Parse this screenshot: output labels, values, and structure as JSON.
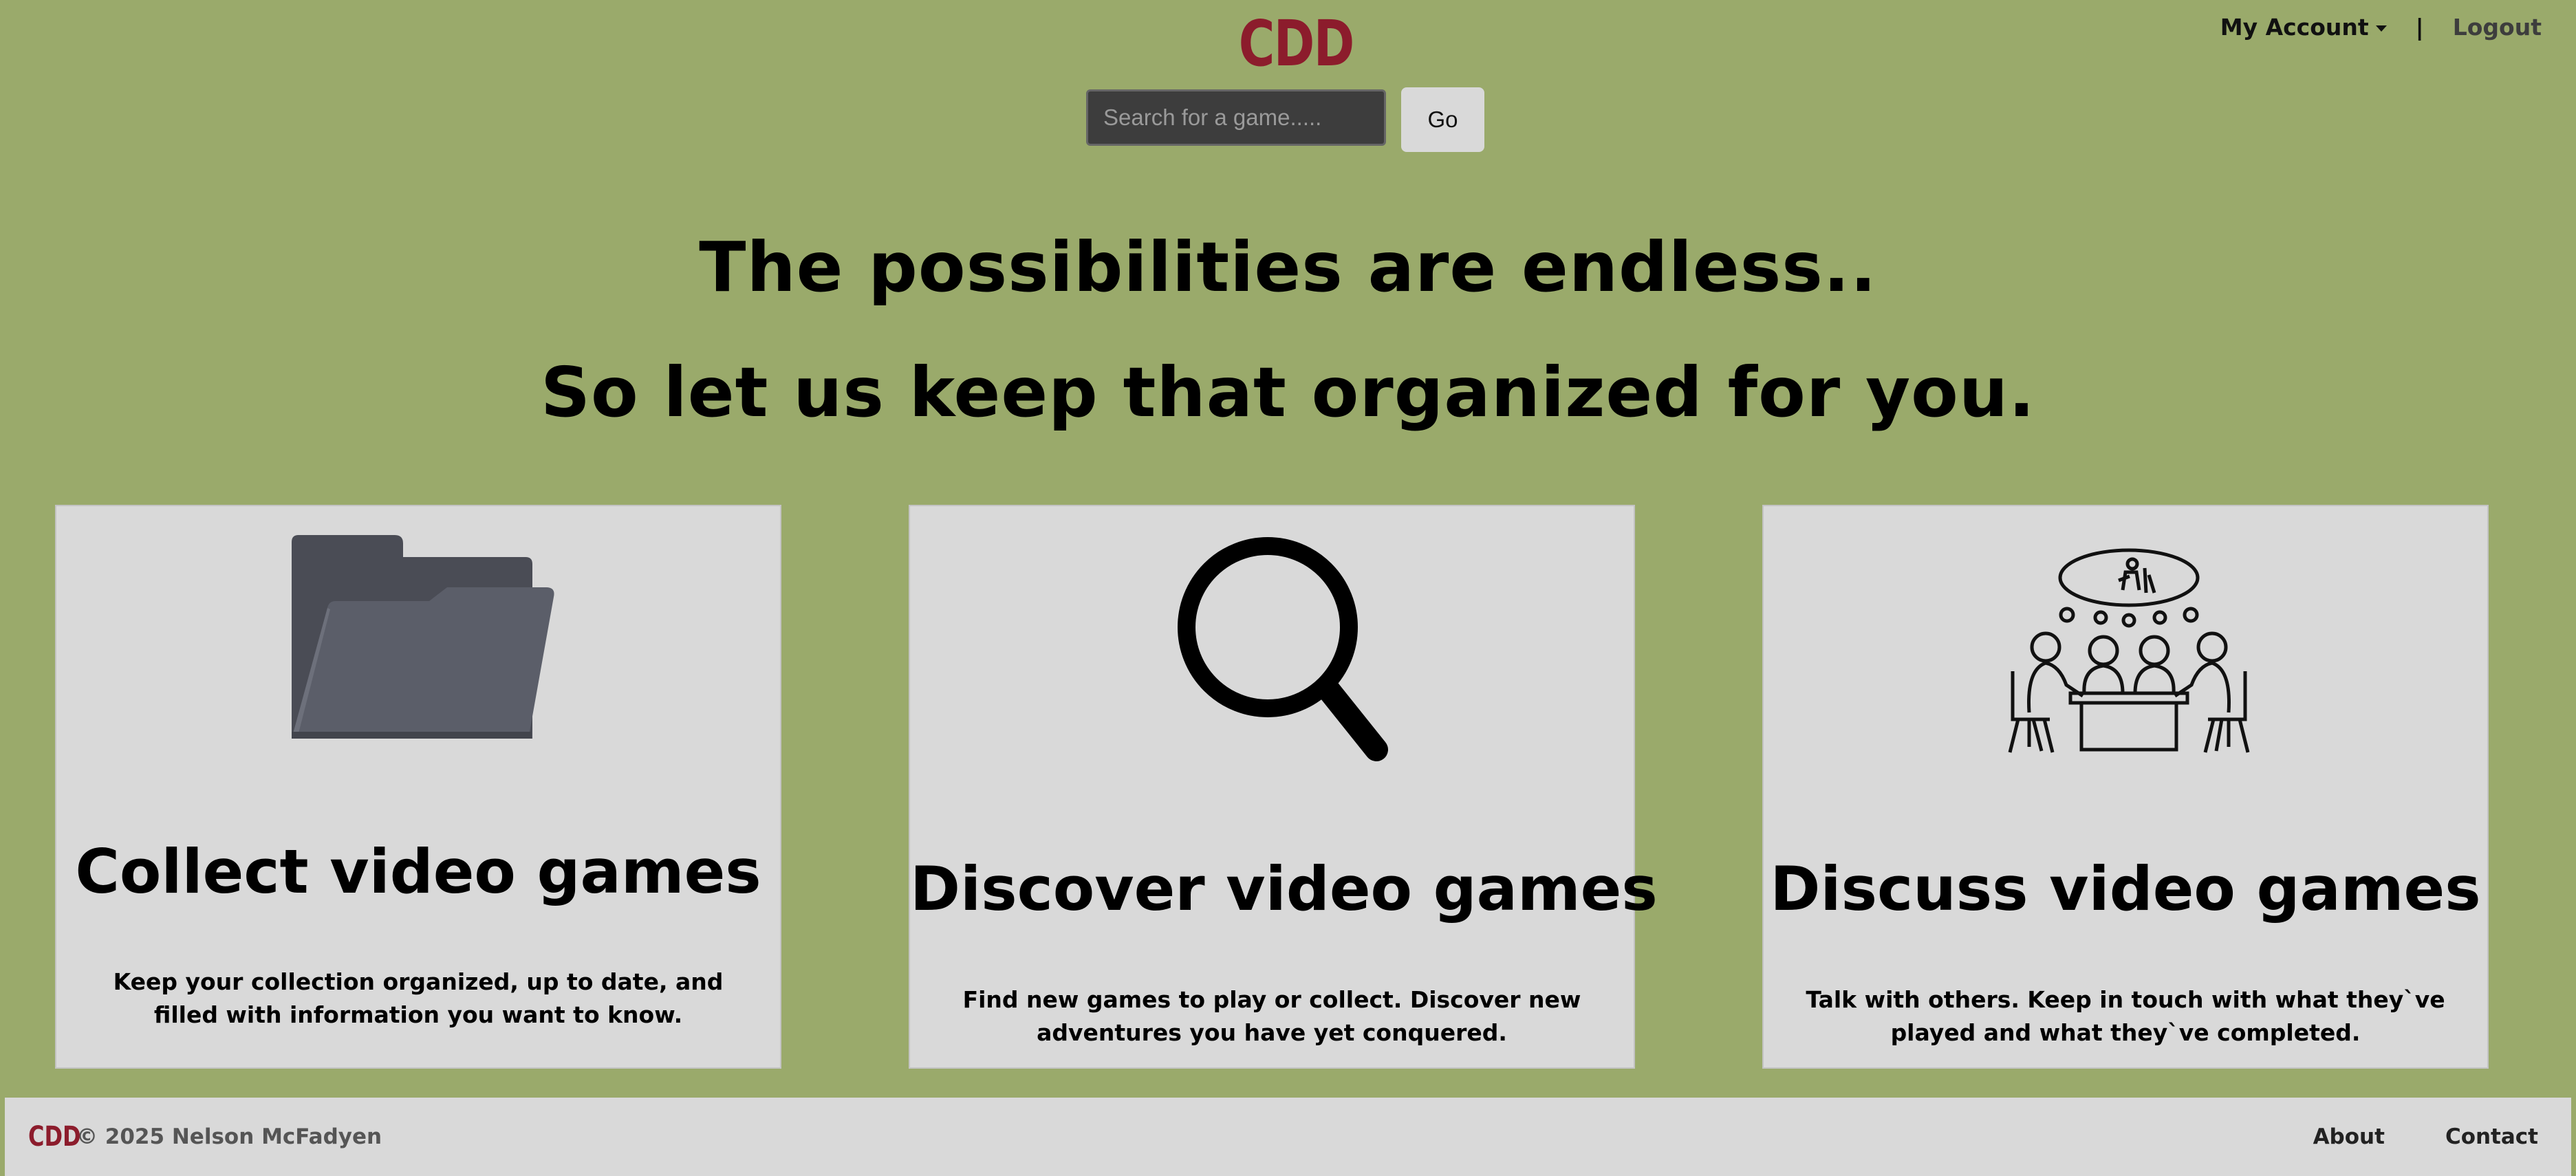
{
  "header": {
    "logo": "CDD",
    "account_label": "My Account",
    "separator": "|",
    "logout_label": "Logout"
  },
  "search": {
    "placeholder": "Search for a game.....",
    "value": "",
    "go_label": "Go"
  },
  "hero": {
    "line1": "The possibilities are endless..",
    "line2": "So let us keep that organized for you."
  },
  "cards": [
    {
      "icon": "folder-icon",
      "title": "Collect video games",
      "text": "Keep your collection organized, up to date, and filled with information you want to know."
    },
    {
      "icon": "magnifier-icon",
      "title": "Discover video games",
      "text": "Find new games to play or collect. Discover new adventures you have yet conquered."
    },
    {
      "icon": "people-discussion-icon",
      "title": "Discuss video games",
      "text": "Talk with others. Keep in touch with what they`ve played and what they`ve completed."
    }
  ],
  "footer": {
    "logo": "CDD",
    "copyright": "© 2025 Nelson McFadyen",
    "links": [
      "About",
      "Contact"
    ]
  },
  "colors": {
    "background": "#9aaa6b",
    "brand": "#8c1c2c",
    "card": "#d9d9d9"
  }
}
